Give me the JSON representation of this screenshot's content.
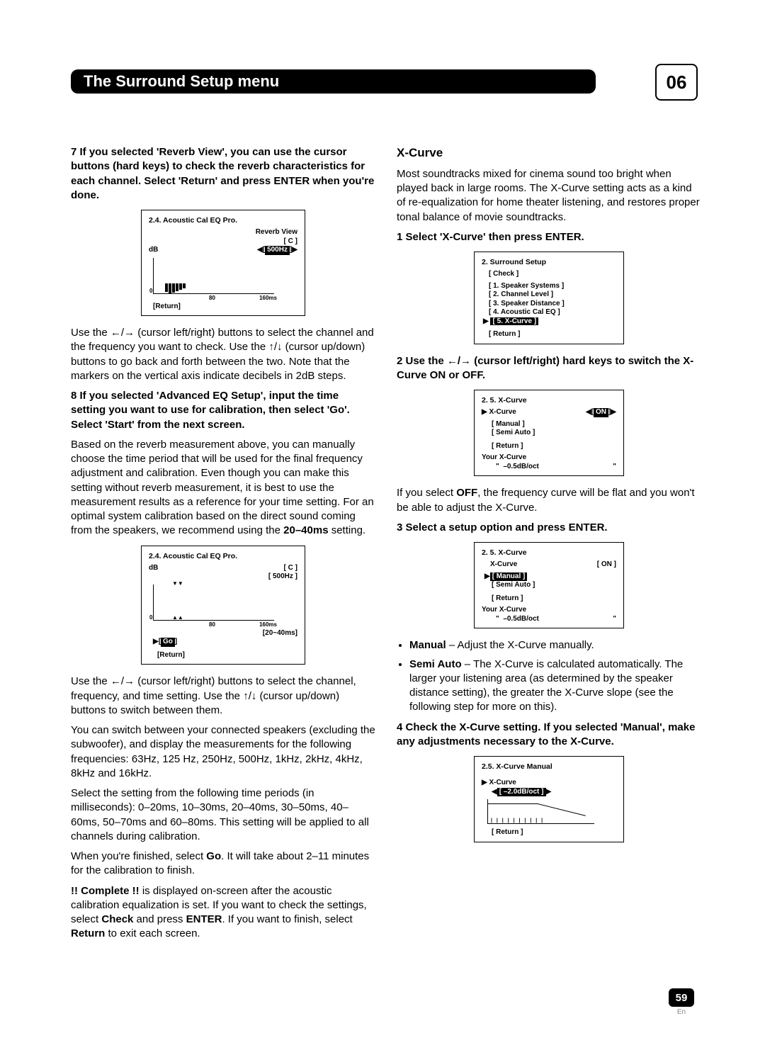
{
  "chapter": "06",
  "header_title": "The Surround Setup menu",
  "page_number": "59",
  "lang": "En",
  "left": {
    "step7_heading": "7   If you selected 'Reverb View', you can use the cursor buttons (hard keys) to check the reverb characteristics for each channel. Select 'Return' and press ENTER when you're done.",
    "osd1": {
      "title": "2.4. Acoustic  Cal  EQ  Pro.",
      "subtitle": "Reverb View",
      "ch": "[  C  ]",
      "freq": "500Hz",
      "db": "dB",
      "zero": "0",
      "x80": "80",
      "x160": "160ms",
      "return": "[Return]"
    },
    "p7a_pre": "Use the ",
    "p7a_mid": " (cursor left/right) buttons to select the channel and the frequency you want to check. Use the ",
    "p7a_end": " (cursor up/down) buttons to go back and forth between the two. Note that the markers on the vertical axis indicate decibels in 2dB steps.",
    "step8_heading": "8   If you selected 'Advanced EQ Setup', input the time setting you want to use for calibration, then select 'Go'. Select 'Start' from the next screen.",
    "p8a_pre": "Based on the reverb measurement above, you can manually choose the time period that will be used for the final frequency adjustment and calibration. Even though you can make this setting without reverb measurement, it is best to use the measurement results as a reference for your time setting. For an optimal system calibration based on the direct sound coming from the speakers, we recommend using the ",
    "p8a_bold": "20–40ms",
    "p8a_end": " setting.",
    "osd2": {
      "title": "2.4. Acoustic  Cal  EQ  Pro.",
      "ch": "[  C  ]",
      "freq": "[ 500Hz ]",
      "db": "dB",
      "zero": "0",
      "x80": "80",
      "x160": "160ms",
      "range": "[20~40ms]",
      "go": "Go",
      "return": "[Return]"
    },
    "p8b_pre": "Use the ",
    "p8b_mid": " (cursor left/right) buttons to select the channel, frequency, and time setting. Use the ",
    "p8b_end": " (cursor up/down) buttons to switch between them.",
    "p8c": "You can switch between your connected speakers (excluding the subwoofer), and display the measurements for the following frequencies: 63Hz, 125 Hz, 250Hz, 500Hz, 1kHz, 2kHz, 4kHz, 8kHz and 16kHz.",
    "p8d": "Select the setting from the following time periods (in milliseconds): 0–20ms, 10–30ms, 20–40ms, 30–50ms, 40–60ms, 50–70ms and 60–80ms. This setting will be applied to all channels during calibration.",
    "p8e_pre": "When you're finished, select ",
    "p8e_go": "Go",
    "p8e_end": ". It will take about 2–11 minutes for the calibration to finish.",
    "p8f_complete": "!! Complete !!",
    "p8f_mid1": " is displayed on-screen after the acoustic calibration equalization is set. If you want to check the settings, select ",
    "p8f_check": "Check",
    "p8f_mid2": " and press ",
    "p8f_enter": "ENTER",
    "p8f_mid3": ". If you want to finish, select ",
    "p8f_return": "Return",
    "p8f_end": " to exit each screen."
  },
  "right": {
    "heading": "X-Curve",
    "intro": "Most soundtracks mixed for cinema sound too bright when played back in large rooms. The X-Curve setting acts as a kind of re-equalization for home theater listening, and restores proper tonal balance of movie soundtracks.",
    "step1": "1   Select 'X-Curve' then press ENTER.",
    "osd3": {
      "title": "2. Surround Setup",
      "check": "[ Check ]",
      "i1": "[ 1. Speaker Systems ]",
      "i2": "[ 2. Channel Level ]",
      "i3": "[ 3. Speaker Distance ]",
      "i4": "[ 4. Acoustic Cal EQ ]",
      "i5": "[ 5. X-Curve ]",
      "return": "[ Return ]"
    },
    "step2_pre": "2   Use the ",
    "step2_end": " (cursor left/right) hard keys to switch the X-Curve ON or OFF.",
    "osd4": {
      "title": "2. 5. X-Curve",
      "xcurve": "X-Curve",
      "on": "ON",
      "manual": "[ Manual ]",
      "semi": "[ Semi Auto ]",
      "return": "[ Return ]",
      "your": "Your X-Curve",
      "val": "–0.5dB/oct",
      "quote": "\""
    },
    "p2a_pre": "If you select ",
    "p2a_off": "OFF",
    "p2a_end": ", the frequency curve will be flat and you won't be able to adjust the X-Curve.",
    "step3": "3   Select a setup option and press ENTER.",
    "osd5": {
      "title": "2. 5. X-Curve",
      "xcurve": "X-Curve",
      "on": "[ ON ]",
      "manual": "[ Manual ]",
      "semi": "[ Semi Auto ]",
      "return": "[ Return ]",
      "your": "Your X-Curve",
      "val": "–0.5dB/oct",
      "quote": "\""
    },
    "bullet1_label": "Manual",
    "bullet1_text": " – Adjust the X-Curve manually.",
    "bullet2_label": "Semi Auto",
    "bullet2_text": " – The X-Curve is calculated automatically. The larger your listening area (as determined by the speaker distance setting), the greater the X-Curve slope (see the following step for more on this).",
    "step4": "4   Check the X-Curve setting. If you selected 'Manual', make any adjustments necessary to the X-Curve.",
    "osd6": {
      "title": "2.5. X-Curve  Manual",
      "xcurve": "X-Curve",
      "val": "–2.0dB/oct",
      "return": "[ Return ]"
    }
  }
}
